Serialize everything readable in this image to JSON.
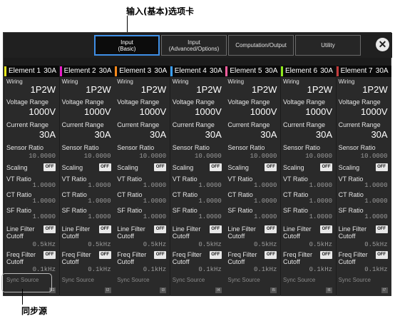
{
  "callouts": {
    "top": "输入(基本)选项卡",
    "bottom": "同步源"
  },
  "tabs": [
    {
      "label_line1": "Input",
      "label_line2": "(Basic)",
      "active": true
    },
    {
      "label_line1": "Input",
      "label_line2": "(Advanced/Options)",
      "active": false
    },
    {
      "label_line1": "Computation/Output",
      "label_line2": "",
      "active": false
    },
    {
      "label_line1": "Utility",
      "label_line2": "",
      "active": false
    }
  ],
  "close_icon": "✕",
  "labels": {
    "wiring": "Wiring",
    "voltage_range": "Voltage Range",
    "current_range": "Current Range",
    "sensor_ratio": "Sensor Ratio",
    "scaling": "Scaling",
    "vt_ratio": "VT Ratio",
    "ct_ratio": "CT Ratio",
    "sf_ratio": "SF Ratio",
    "line_filter_1": "Line Filter",
    "line_filter_2": "Cutoff",
    "freq_filter_1": "Freq Filter",
    "freq_filter_2": "Cutoff",
    "sync_source": "Sync Source",
    "off": "OFF"
  },
  "elements": [
    {
      "name": "Element 1",
      "current": "30A",
      "color": "#e8e81c",
      "wiring": "1P2W",
      "voltage_range": "1000V",
      "current_range": "30A",
      "sensor_ratio": "10.0000",
      "vt_ratio": "1.0000",
      "ct_ratio": "1.0000",
      "sf_ratio": "1.0000",
      "line_filter_cutoff": "0.5kHz",
      "freq_filter_cutoff": "0.1kHz",
      "sync_num": "E1"
    },
    {
      "name": "Element 2",
      "current": "30A",
      "color": "#e81cc8",
      "wiring": "1P2W",
      "voltage_range": "1000V",
      "current_range": "30A",
      "sensor_ratio": "10.0000",
      "vt_ratio": "1.0000",
      "ct_ratio": "1.0000",
      "sf_ratio": "1.0000",
      "line_filter_cutoff": "0.5kHz",
      "freq_filter_cutoff": "0.1kHz",
      "sync_num": "I2"
    },
    {
      "name": "Element 3",
      "current": "30A",
      "color": "#ff8a1c",
      "wiring": "1P2W",
      "voltage_range": "1000V",
      "current_range": "30A",
      "sensor_ratio": "10.0000",
      "vt_ratio": "1.0000",
      "ct_ratio": "1.0000",
      "sf_ratio": "1.0000",
      "line_filter_cutoff": "0.5kHz",
      "freq_filter_cutoff": "0.1kHz",
      "sync_num": "I3"
    },
    {
      "name": "Element 4",
      "current": "30A",
      "color": "#3aa0ff",
      "wiring": "1P2W",
      "voltage_range": "1000V",
      "current_range": "30A",
      "sensor_ratio": "10.0000",
      "vt_ratio": "1.0000",
      "ct_ratio": "1.0000",
      "sf_ratio": "1.0000",
      "line_filter_cutoff": "0.5kHz",
      "freq_filter_cutoff": "0.1kHz",
      "sync_num": "I4"
    },
    {
      "name": "Element 5",
      "current": "30A",
      "color": "#ff5e9e",
      "wiring": "1P2W",
      "voltage_range": "1000V",
      "current_range": "30A",
      "sensor_ratio": "10.0000",
      "vt_ratio": "1.0000",
      "ct_ratio": "1.0000",
      "sf_ratio": "1.0000",
      "line_filter_cutoff": "0.5kHz",
      "freq_filter_cutoff": "0.1kHz",
      "sync_num": "I5"
    },
    {
      "name": "Element 6",
      "current": "30A",
      "color": "#8ee81c",
      "wiring": "1P2W",
      "voltage_range": "1000V",
      "current_range": "30A",
      "sensor_ratio": "10.0000",
      "vt_ratio": "1.0000",
      "ct_ratio": "1.0000",
      "sf_ratio": "1.0000",
      "line_filter_cutoff": "0.5kHz",
      "freq_filter_cutoff": "0.1kHz",
      "sync_num": "I6"
    },
    {
      "name": "Element 7",
      "current": "30A",
      "color": "#c43c3c",
      "wiring": "1P2W",
      "voltage_range": "1000V",
      "current_range": "30A",
      "sensor_ratio": "10.0000",
      "vt_ratio": "1.0000",
      "ct_ratio": "1.0000",
      "sf_ratio": "1.0000",
      "line_filter_cutoff": "0.5kHz",
      "freq_filter_cutoff": "0.1kHz",
      "sync_num": "I7"
    }
  ]
}
